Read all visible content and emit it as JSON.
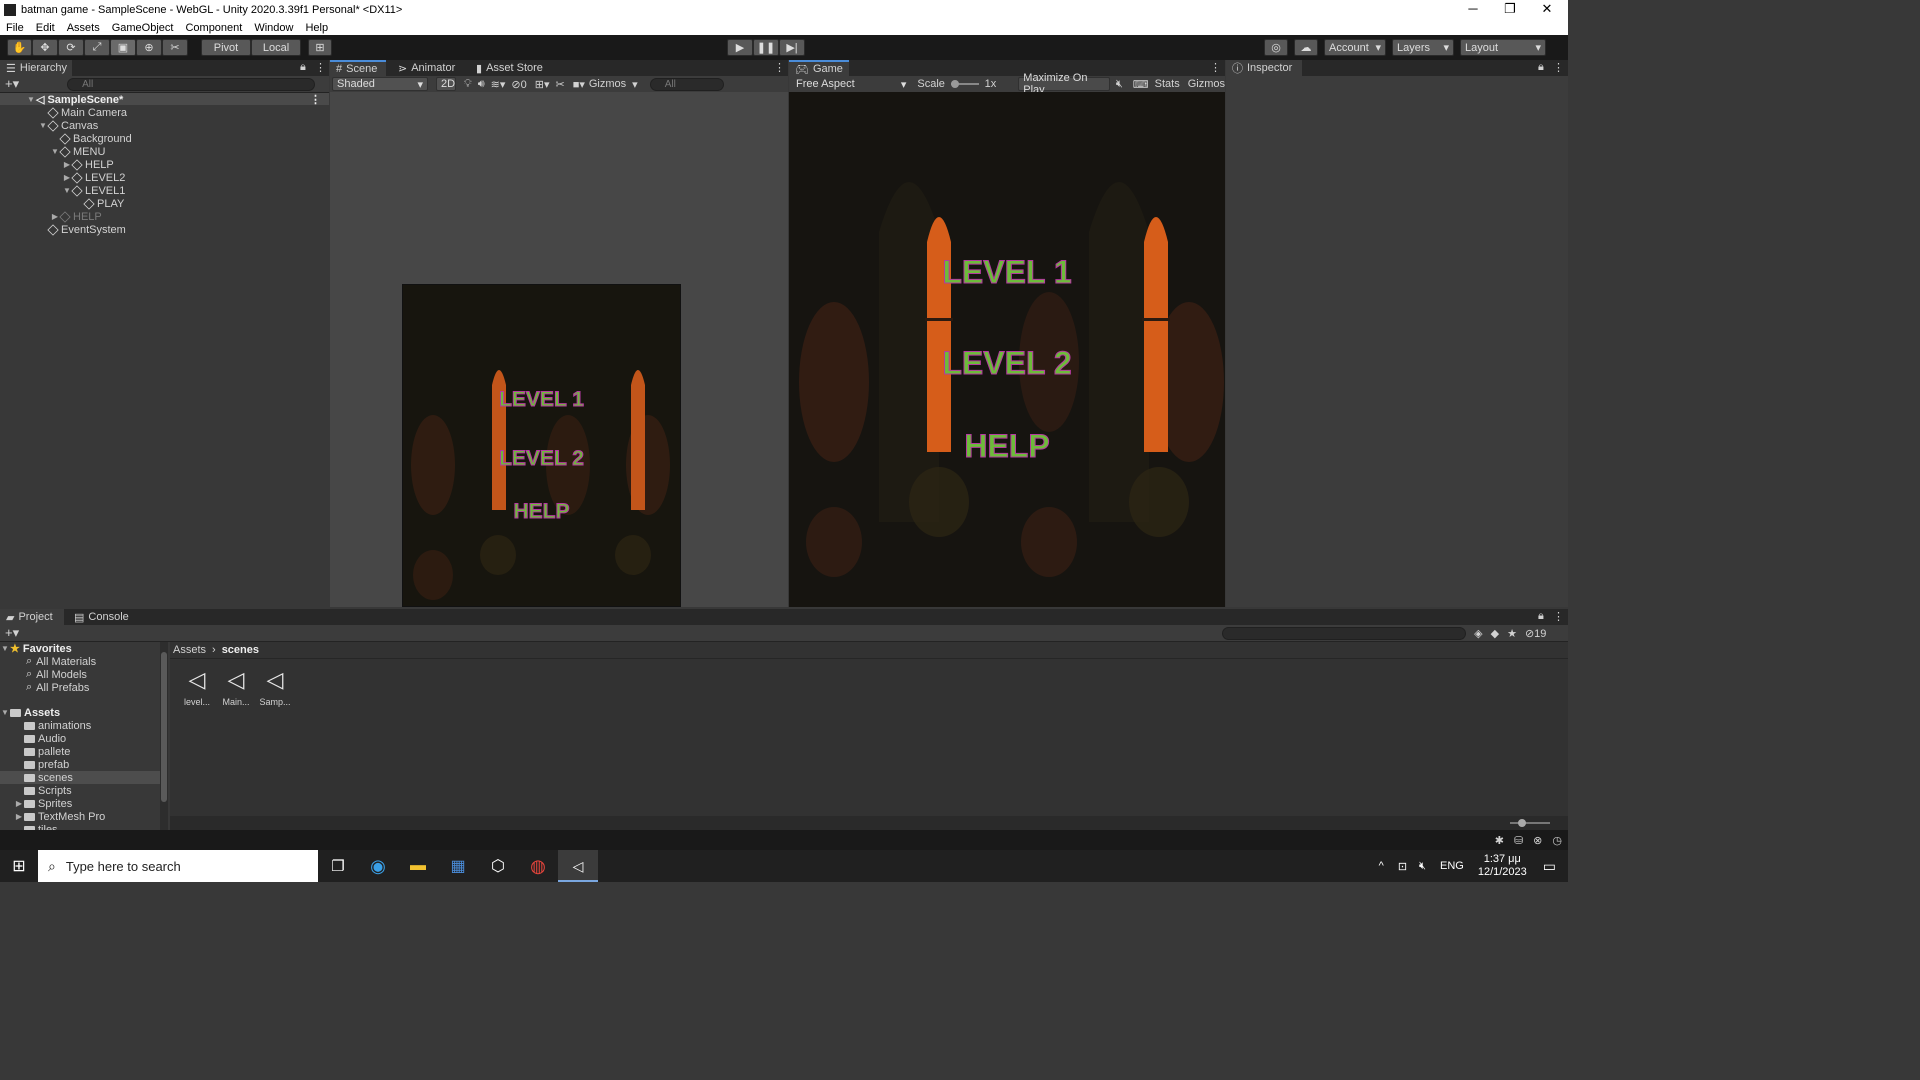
{
  "title": "batman game - SampleScene - WebGL - Unity 2020.3.39f1 Personal* <DX11>",
  "window_controls": {
    "minimize": "─",
    "restore": "❐",
    "close": "✕"
  },
  "menu": [
    "File",
    "Edit",
    "Assets",
    "GameObject",
    "Component",
    "Window",
    "Help"
  ],
  "toolbar": {
    "pivot": "Pivot",
    "local": "Local",
    "account": "Account",
    "layers": "Layers",
    "layout": "Layout"
  },
  "hierarchy": {
    "tab": "Hierarchy",
    "search_placeholder": "All",
    "scene": "SampleScene*",
    "items": [
      {
        "label": "Main Camera",
        "depth": 1,
        "arrow": ""
      },
      {
        "label": "Canvas",
        "depth": 1,
        "arrow": "▼"
      },
      {
        "label": "Background",
        "depth": 2,
        "arrow": ""
      },
      {
        "label": "MENU",
        "depth": 2,
        "arrow": "▼"
      },
      {
        "label": "HELP",
        "depth": 3,
        "arrow": "▶"
      },
      {
        "label": "LEVEL2",
        "depth": 3,
        "arrow": "▶"
      },
      {
        "label": "LEVEL1",
        "depth": 3,
        "arrow": "▼"
      },
      {
        "label": "PLAY",
        "depth": 4,
        "arrow": ""
      },
      {
        "label": "HELP",
        "depth": 2,
        "arrow": "▶",
        "dim": true
      },
      {
        "label": "EventSystem",
        "depth": 1,
        "arrow": ""
      }
    ]
  },
  "scene": {
    "tabs": [
      "Scene",
      "Animator",
      "Asset Store"
    ],
    "shading": "Shaded",
    "mode_2d": "2D",
    "hidden_count": "0",
    "gizmos": "Gizmos",
    "search_placeholder": "All"
  },
  "game": {
    "tab": "Game",
    "aspect": "Free Aspect",
    "scale_label": "Scale",
    "scale_value": "1x",
    "maximize": "Maximize On Play",
    "stats": "Stats",
    "gizmos": "Gizmos",
    "menu_items": [
      "LEVEL 1",
      "LEVEL 2",
      "HELP"
    ]
  },
  "inspector": {
    "tab": "Inspector"
  },
  "project": {
    "tabs": [
      "Project",
      "Console"
    ],
    "favorites_label": "Favorites",
    "favorites": [
      "All Materials",
      "All Models",
      "All Prefabs"
    ],
    "assets_label": "Assets",
    "folders": [
      {
        "label": "animations",
        "arrow": ""
      },
      {
        "label": "Audio",
        "arrow": ""
      },
      {
        "label": "pallete",
        "arrow": ""
      },
      {
        "label": "prefab",
        "arrow": ""
      },
      {
        "label": "scenes",
        "arrow": "",
        "selected": true
      },
      {
        "label": "Scripts",
        "arrow": ""
      },
      {
        "label": "Sprites",
        "arrow": "▶"
      },
      {
        "label": "TextMesh Pro",
        "arrow": "▶"
      },
      {
        "label": "tiles",
        "arrow": ""
      }
    ],
    "breadcrumb": [
      "Assets",
      "scenes"
    ],
    "files": [
      "level...",
      "Main...",
      "Samp..."
    ],
    "hidden_count": "19"
  },
  "taskbar": {
    "search_placeholder": "Type here to search",
    "language": "ENG",
    "time": "1:37 μμ",
    "date": "12/1/2023"
  }
}
